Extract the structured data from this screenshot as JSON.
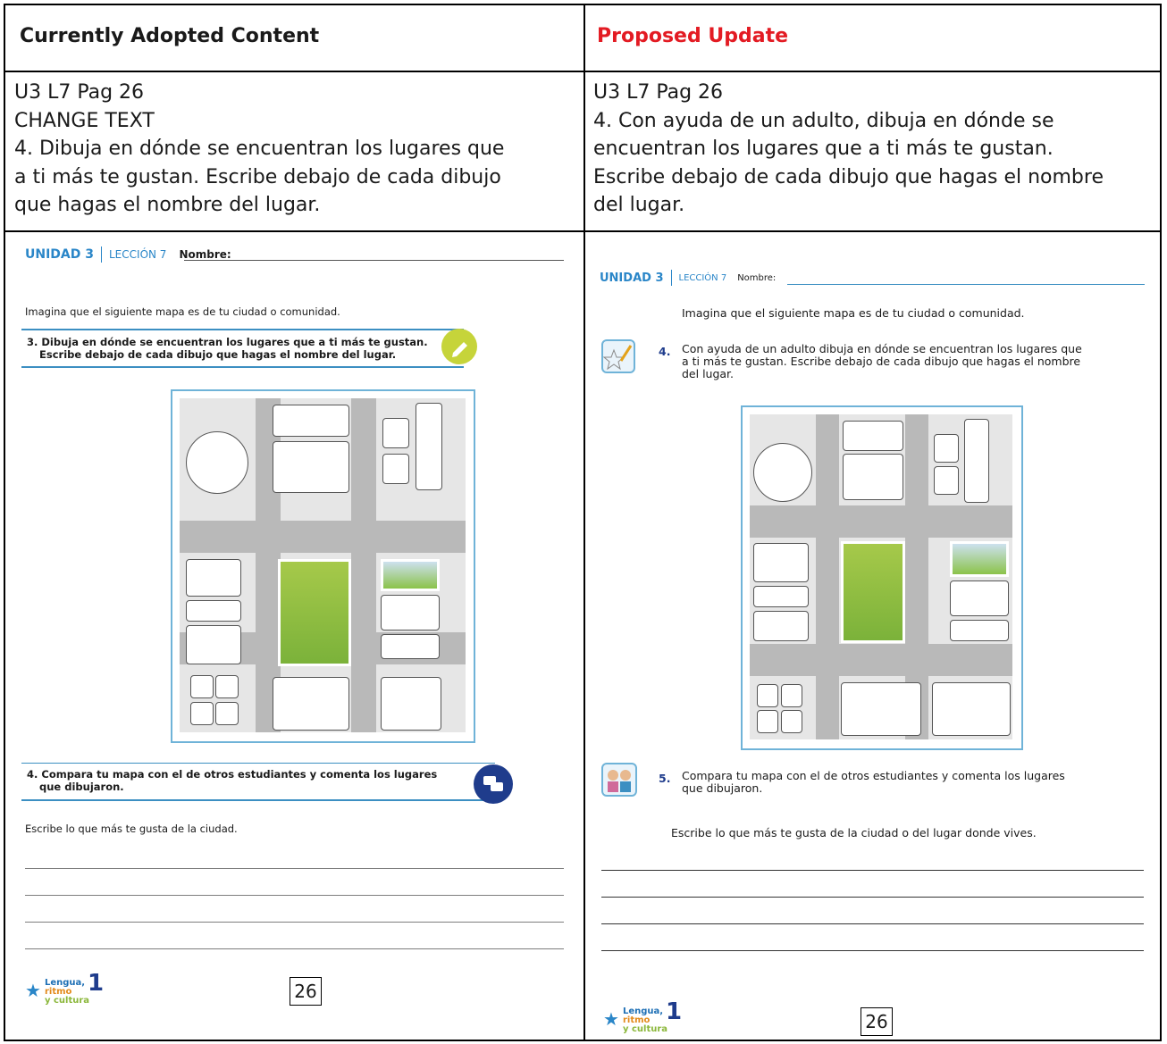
{
  "header": {
    "left": "Currently Adopted Content",
    "right": "Proposed Update",
    "right_color": "#e31b23"
  },
  "left_text": {
    "line1": "U3 L7 Pag 26",
    "line2": "CHANGE TEXT",
    "line3": "4. Dibuja en dónde se encuentran los lugares que",
    "line4": "a ti más te gustan. Escribe debajo de cada dibujo",
    "line5": "que hagas el nombre del lugar."
  },
  "right_text": {
    "line1": "U3 L7 Pag 26",
    "line2": "4. Con ayuda de un adulto, dibuja en dónde se",
    "line3": "encuentran los lugares que a ti más te gustan.",
    "line4": "Escribe debajo de cada dibujo que hagas el nombre",
    "line5": "del lugar."
  },
  "left_ws": {
    "unidad": "UNIDAD 3",
    "leccion": "LECCIÓN 7",
    "nombre": "Nombre:",
    "intro": "Imagina que el siguiente mapa es de tu ciudad o comunidad.",
    "q3_line1": "3. Dibuja en dónde se encuentran los lugares que a ti más te gustan.",
    "q3_line2": "Escribe debajo de cada dibujo que hagas el nombre del lugar.",
    "q4_line1": "4. Compara tu mapa con el de otros estudiantes y comenta los lugares",
    "q4_line2": "que dibujaron.",
    "write": "Escribe lo que más te gusta de la ciudad.",
    "page": "26"
  },
  "right_ws": {
    "unidad": "UNIDAD 3",
    "leccion": "LECCIÓN 7",
    "nombre": "Nombre:",
    "intro": "Imagina que el siguiente mapa es de tu ciudad o comunidad.",
    "q4_num": "4.",
    "q4_line1": "Con ayuda de un adulto dibuja en dónde se encuentran los lugares que",
    "q4_line2": "a ti más te gustan. Escribe debajo de cada dibujo que hagas el nombre",
    "q4_line3": "del lugar.",
    "q5_num": "5.",
    "q5_line1": "Compara tu mapa con el de otros estudiantes y comenta los lugares",
    "q5_line2": "que dibujaron.",
    "write": "Escribe lo que más te gusta de la ciudad o del lugar donde vives.",
    "page": "26"
  },
  "logo": {
    "lengua": "Lengua,",
    "ritmo": "ritmo",
    "cultura": "y cultura",
    "grade": "1"
  },
  "colors": {
    "accent_blue": "#2a86c8",
    "icon_yellow": "#c6d43a",
    "icon_navy": "#1f3c8c"
  }
}
